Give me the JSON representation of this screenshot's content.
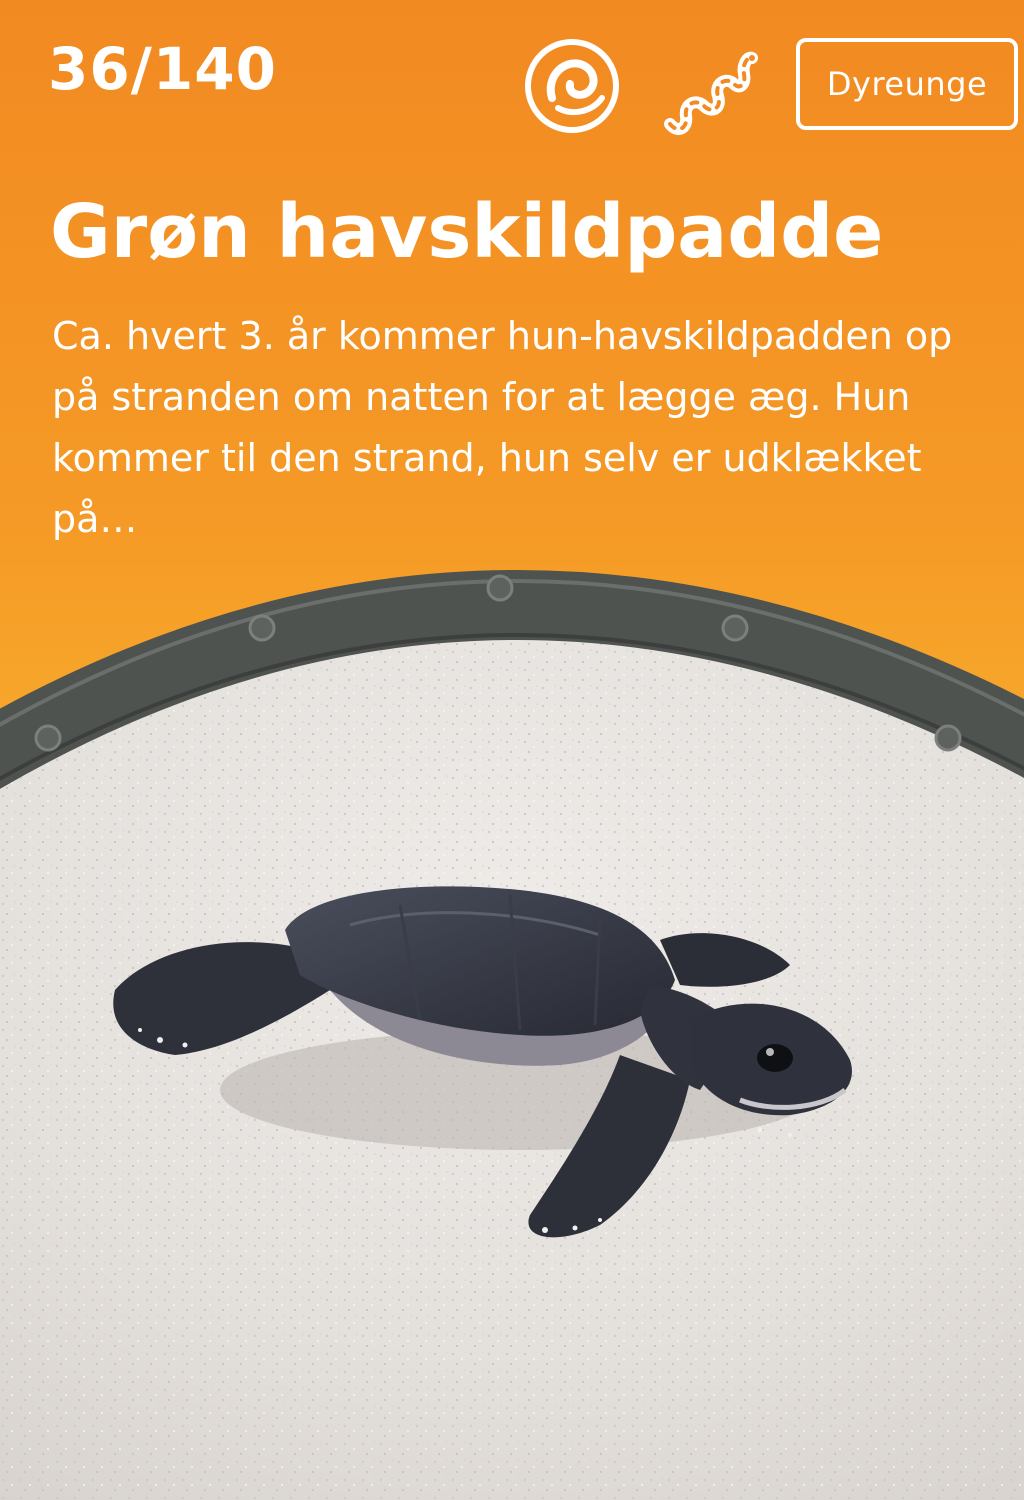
{
  "card": {
    "counter": "36/140",
    "category_label": "Dyreunge",
    "title": "Grøn havskildpadde",
    "description": "Ca. hvert 3. år kommer hun-havskildpadden op på stranden om natten for at lægge æg. Hun kommer til den strand, hun selv er udklækket på…",
    "icons": [
      "ocean-swirl-icon",
      "snake-icon"
    ],
    "colors": {
      "background_top": "#F28A22",
      "background_bottom": "#F6B233",
      "text": "#FFFFFF",
      "ring": "#4F5350",
      "sand": "#E6E2DE",
      "turtle": "#2F323C"
    }
  }
}
